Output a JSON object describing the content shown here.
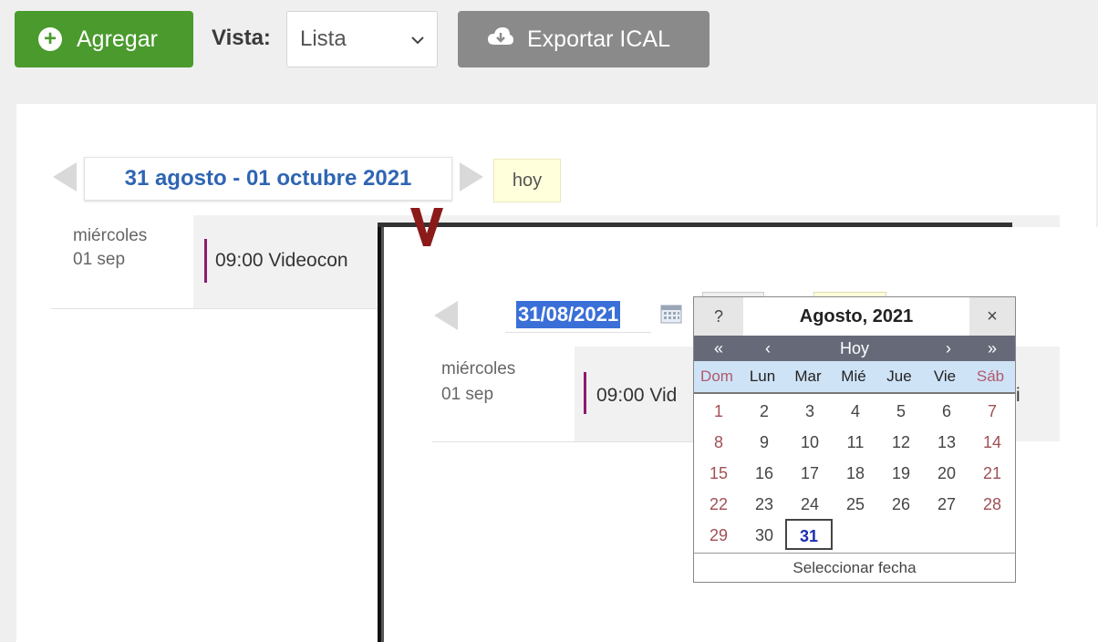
{
  "toolbar": {
    "add_label": "Agregar",
    "vista_label": "Vista:",
    "vista_value": "Lista",
    "export_label": "Exportar ICAL"
  },
  "calendar_view": {
    "range_label": "31 agosto - 01 octubre 2021",
    "today_label": "hoy",
    "day_name": "miércoles",
    "day_date": "01 sep",
    "event_text": "09:00 Videocon"
  },
  "inset": {
    "date_value": "31/08/2021",
    "day_name": "miércoles",
    "day_date": "01 sep",
    "event_text": "09:00 Vid",
    "event_tail": "i"
  },
  "datepicker": {
    "help": "?",
    "title": "Agosto, 2021",
    "close": "×",
    "nav": [
      "«",
      "‹",
      "Hoy",
      "›",
      "»"
    ],
    "weekdays": [
      "Dom",
      "Lun",
      "Mar",
      "Mié",
      "Jue",
      "Vie",
      "Sáb"
    ],
    "weeks": [
      [
        "1",
        "2",
        "3",
        "4",
        "5",
        "6",
        "7"
      ],
      [
        "8",
        "9",
        "10",
        "11",
        "12",
        "13",
        "14"
      ],
      [
        "15",
        "16",
        "17",
        "18",
        "19",
        "20",
        "21"
      ],
      [
        "22",
        "23",
        "24",
        "25",
        "26",
        "27",
        "28"
      ],
      [
        "29",
        "30",
        "31",
        "",
        "",
        "",
        ""
      ]
    ],
    "selected_day": "31",
    "footer": "Seleccionar fecha"
  },
  "colors": {
    "add_button": "#4a9a2e",
    "export_button": "#8a8a8a",
    "range_text": "#2f65b3",
    "event_bar": "#8d1b6f",
    "marker": "#8b1a1a"
  }
}
